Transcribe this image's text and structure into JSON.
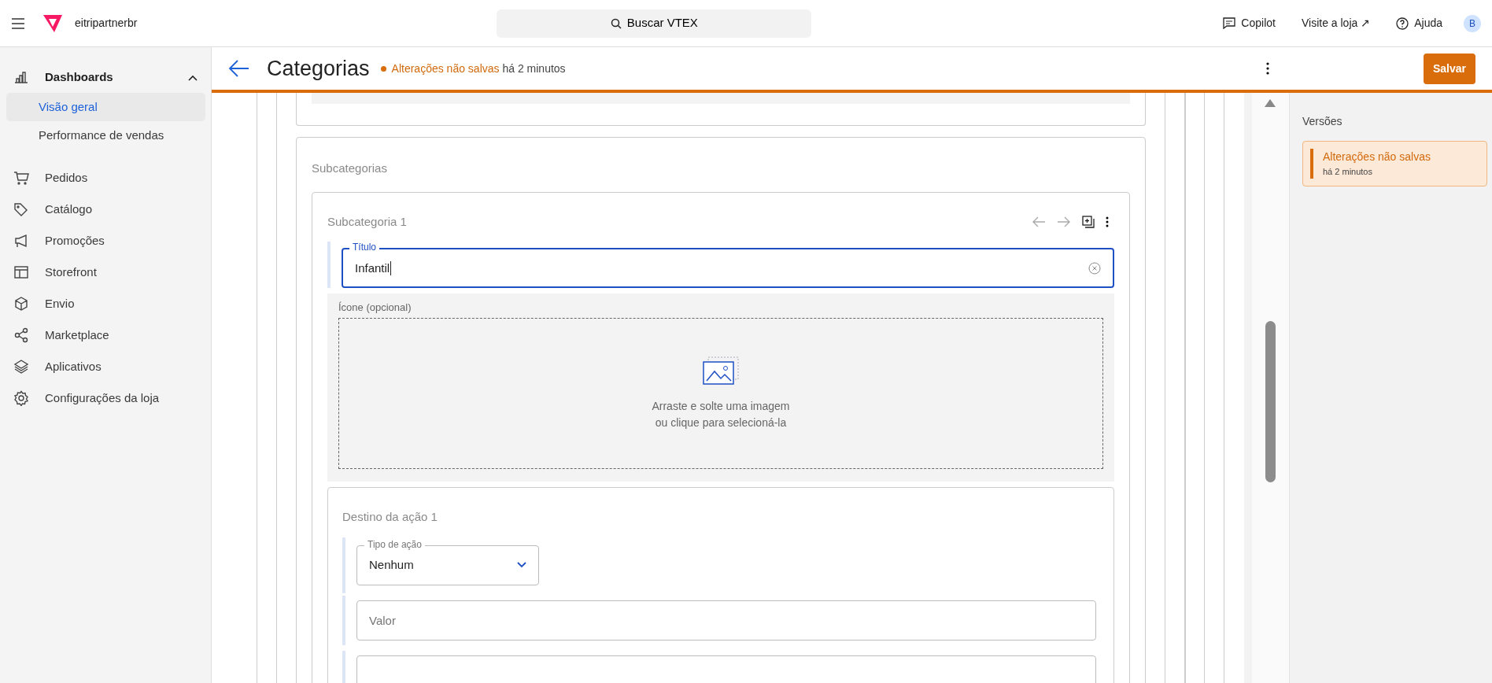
{
  "topbar": {
    "store": "eitripartnerbr",
    "search": "Buscar VTEX",
    "links": [
      {
        "kind": "copilot",
        "label": "Copilot"
      },
      {
        "kind": "external",
        "label": "Visite a loja ↗"
      },
      {
        "kind": "help",
        "label": "Ajuda"
      }
    ],
    "avatar": "B"
  },
  "sidebar": {
    "items": [
      {
        "label": "Dashboards",
        "expanded": true,
        "children": [
          {
            "label": "Visão geral",
            "selected": true
          },
          {
            "label": "Performance de vendas",
            "selected": false
          }
        ]
      },
      {
        "label": "Pedidos"
      },
      {
        "label": "Catálogo"
      },
      {
        "label": "Promoções"
      },
      {
        "label": "Storefront"
      },
      {
        "label": "Envio"
      },
      {
        "label": "Marketplace"
      },
      {
        "label": "Aplicativos"
      },
      {
        "label": "Configurações da loja"
      }
    ]
  },
  "header": {
    "title": "Categorias",
    "status": "Alterações não salvas",
    "time": "há 2 minutos",
    "save": "Salvar"
  },
  "editor": {
    "section": "Subcategorias",
    "item_title": "Subcategoria 1",
    "title_field": {
      "label": "Título",
      "value": "Infantil"
    },
    "icon_label": "Ícone (opcional)",
    "dropzone": [
      "Arraste e solte uma imagem",
      "ou clique para selecioná-la"
    ],
    "action": {
      "title": "Destino da ação 1",
      "type_field": {
        "label": "Tipo de ação",
        "value": "Nenhum"
      },
      "value_field": {
        "placeholder": "Valor"
      }
    }
  },
  "versions": {
    "title": "Versões",
    "items": [
      {
        "label": "Alterações não salvas",
        "time": "há 2 minutos",
        "selected": true
      }
    ]
  }
}
